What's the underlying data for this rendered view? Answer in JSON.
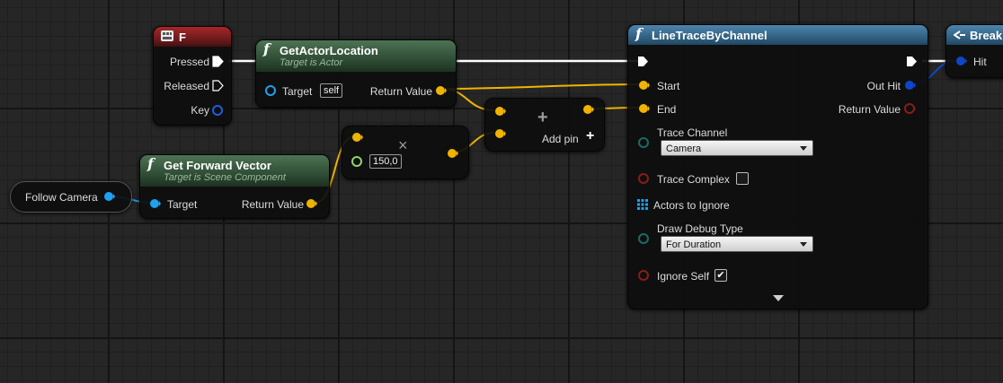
{
  "nodes": {
    "event_f": {
      "title": "F",
      "pins": {
        "pressed": "Pressed",
        "released": "Released",
        "key": "Key"
      }
    },
    "get_actor_location": {
      "title": "GetActorLocation",
      "subtitle": "Target is Actor",
      "pins": {
        "target": "Target",
        "target_default": "self",
        "return": "Return Value"
      }
    },
    "get_forward_vector": {
      "title": "Get Forward Vector",
      "subtitle": "Target is Scene Component",
      "pins": {
        "target": "Target",
        "return": "Return Value"
      }
    },
    "follow_camera": {
      "label": "Follow Camera"
    },
    "multiply": {
      "symbol": "×",
      "value": "150,0"
    },
    "add": {
      "symbol": "+",
      "add_pin": "Add pin"
    },
    "line_trace": {
      "title": "LineTraceByChannel",
      "pins": {
        "start": "Start",
        "end": "End",
        "trace_channel": "Trace Channel",
        "trace_channel_value": "Camera",
        "trace_complex": "Trace Complex",
        "actors_to_ignore": "Actors to Ignore",
        "draw_debug_type": "Draw Debug Type",
        "draw_debug_value": "For Duration",
        "ignore_self": "Ignore Self",
        "out_hit": "Out Hit",
        "return": "Return Value"
      },
      "trace_complex_checked": false,
      "ignore_self_checked": true
    },
    "break_hit": {
      "title": "Break",
      "pins": {
        "hit": "Hit"
      }
    }
  },
  "colors": {
    "exec": "#ffffff",
    "vector": "#f0b400",
    "object": "#1da1f2",
    "struct": "#0d47c8",
    "boolean": "#8a1c1c",
    "float": "#8fd56d",
    "byte": "#1a6b64"
  },
  "icons": [
    "function-icon",
    "keyboard-icon",
    "struct-icon",
    "grid-array-icon",
    "expand-arrow-icon",
    "add-icon",
    "multiply-icon"
  ]
}
